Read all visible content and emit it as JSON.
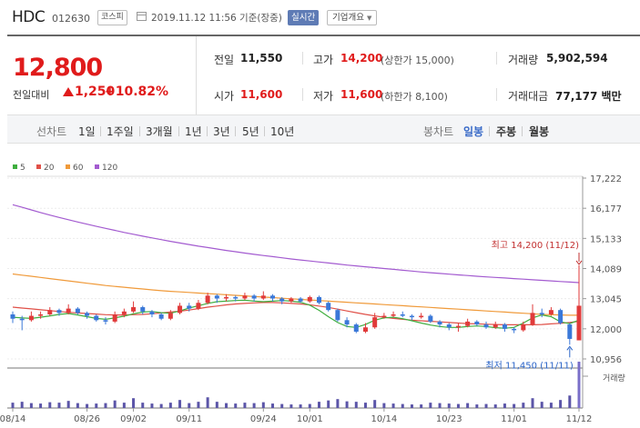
{
  "header": {
    "name": "HDC",
    "code": "012630",
    "market_badge": "코스피",
    "datetime": "2019.11.12 11:56 기준(장중)",
    "realtime_button": "실시간",
    "company_info_label": "기업개요"
  },
  "quote": {
    "price": "12,800",
    "change_label": "전일대비",
    "change_value": "1,250",
    "change_pct": "+10.82%",
    "prev_label": "전일",
    "prev_value": "11,550",
    "high_label": "고가",
    "high_value": "14,200",
    "upper_limit": "(상한가 15,000)",
    "volume_label": "거래량",
    "volume_value": "5,902,594",
    "open_label": "시가",
    "open_value": "11,600",
    "low_label": "저가",
    "low_value": "11,600",
    "lower_limit": "(하한가 8,100)",
    "amount_label": "거래대금",
    "amount_value": "77,177 백만"
  },
  "toolbar": {
    "line_chart_label": "선차트",
    "periods": [
      "1일",
      "1주일",
      "3개월",
      "1년",
      "3년",
      "5년",
      "10년"
    ],
    "candle_chart_label": "봉차트",
    "candle_periods": [
      "일봉",
      "주봉",
      "월봉"
    ],
    "active_candle": "일봉"
  },
  "chart_data": {
    "type": "candlestick",
    "legend": [
      "5",
      "20",
      "60",
      "120"
    ],
    "ma_colors": {
      "5": "#3fae3f",
      "20": "#e05048",
      "60": "#f09a3a",
      "120": "#a35bd0"
    },
    "up_color": "#e03a3a",
    "down_color": "#3a78d8",
    "y_ticks": [
      "17,222",
      "16,177",
      "15,133",
      "14,089",
      "13,045",
      "12,000",
      "10,956"
    ],
    "y_tick_values": [
      17222,
      16177,
      15133,
      14089,
      13045,
      12000,
      10956
    ],
    "x_labels": [
      "08/14",
      "08/26",
      "09/02",
      "09/11",
      "09/24",
      "10/01",
      "10/14",
      "10/23",
      "11/01",
      "11/12"
    ],
    "x_label_index": [
      0,
      8,
      13,
      19,
      27,
      32,
      40,
      47,
      54,
      61
    ],
    "volume_label": "거래량",
    "high_annotation": "최고 14,200 (11/12)",
    "low_annotation": "최저 11,450 (11/11)",
    "ma120": [
      16300,
      16210,
      16120,
      16030,
      15940,
      15860,
      15780,
      15700,
      15625,
      15550,
      15480,
      15410,
      15340,
      15275,
      15210,
      15150,
      15090,
      15030,
      14975,
      14920,
      14865,
      14815,
      14765,
      14715,
      14670,
      14625,
      14580,
      14540,
      14500,
      14460,
      14420,
      14385,
      14350,
      14315,
      14280,
      14245,
      14210,
      14180,
      14150,
      14120,
      14090,
      14060,
      14030,
      14000,
      13970,
      13945,
      13920,
      13895,
      13870,
      13845,
      13820,
      13800,
      13780,
      13760,
      13740,
      13720,
      13700,
      13680,
      13660,
      13640,
      13620,
      13600
    ],
    "ma60": [
      13900,
      13860,
      13820,
      13780,
      13740,
      13700,
      13660,
      13620,
      13580,
      13540,
      13500,
      13470,
      13440,
      13410,
      13380,
      13350,
      13320,
      13300,
      13280,
      13260,
      13240,
      13220,
      13200,
      13180,
      13160,
      13140,
      13120,
      13100,
      13080,
      13060,
      13040,
      13020,
      13000,
      12980,
      12960,
      12940,
      12920,
      12900,
      12880,
      12860,
      12840,
      12820,
      12800,
      12780,
      12760,
      12740,
      12720,
      12700,
      12680,
      12660,
      12640,
      12620,
      12600,
      12580,
      12560,
      12540,
      12520,
      12500,
      12490,
      12480,
      12470,
      12470
    ],
    "ma20": [
      12750,
      12720,
      12690,
      12660,
      12630,
      12600,
      12570,
      12550,
      12530,
      12510,
      12490,
      12480,
      12480,
      12490,
      12500,
      12520,
      12550,
      12580,
      12610,
      12650,
      12700,
      12750,
      12790,
      12830,
      12860,
      12880,
      12900,
      12910,
      12910,
      12900,
      12880,
      12860,
      12830,
      12790,
      12740,
      12680,
      12620,
      12560,
      12500,
      12450,
      12400,
      12360,
      12330,
      12300,
      12280,
      12260,
      12240,
      12220,
      12200,
      12180,
      12170,
      12160,
      12150,
      12140,
      12140,
      12140,
      12140,
      12150,
      12170,
      12190,
      12220,
      12260
    ],
    "ma5": [
      12400,
      12380,
      12360,
      12400,
      12450,
      12500,
      12530,
      12480,
      12420,
      12360,
      12330,
      12380,
      12440,
      12520,
      12580,
      12600,
      12560,
      12540,
      12620,
      12720,
      12800,
      12880,
      12940,
      12960,
      12980,
      12990,
      12960,
      12940,
      12960,
      12980,
      12960,
      12920,
      12820,
      12640,
      12420,
      12220,
      12080,
      12050,
      12150,
      12300,
      12380,
      12400,
      12350,
      12280,
      12200,
      12130,
      12080,
      12050,
      12050,
      12080,
      12100,
      12080,
      12040,
      12020,
      12050,
      12200,
      12380,
      12480,
      12420,
      12240,
      12180,
      12300
    ],
    "candles": [
      {
        "o": 12500,
        "c": 12350,
        "h": 12600,
        "l": 12200,
        "v": 60
      },
      {
        "o": 12350,
        "c": 12300,
        "h": 12450,
        "l": 11950,
        "v": 70
      },
      {
        "o": 12300,
        "c": 12450,
        "h": 12600,
        "l": 12250,
        "v": 55
      },
      {
        "o": 12450,
        "c": 12500,
        "h": 12600,
        "l": 12350,
        "v": 50
      },
      {
        "o": 12500,
        "c": 12650,
        "h": 12750,
        "l": 12450,
        "v": 65
      },
      {
        "o": 12650,
        "c": 12550,
        "h": 12700,
        "l": 12450,
        "v": 60
      },
      {
        "o": 12550,
        "c": 12700,
        "h": 12850,
        "l": 12500,
        "v": 80
      },
      {
        "o": 12700,
        "c": 12550,
        "h": 12750,
        "l": 12500,
        "v": 55
      },
      {
        "o": 12550,
        "c": 12450,
        "h": 12600,
        "l": 12350,
        "v": 45
      },
      {
        "o": 12450,
        "c": 12300,
        "h": 12500,
        "l": 12250,
        "v": 50
      },
      {
        "o": 12300,
        "c": 12250,
        "h": 12400,
        "l": 12150,
        "v": 55
      },
      {
        "o": 12250,
        "c": 12500,
        "h": 12600,
        "l": 12200,
        "v": 85
      },
      {
        "o": 12500,
        "c": 12600,
        "h": 12700,
        "l": 12400,
        "v": 60
      },
      {
        "o": 12600,
        "c": 12750,
        "h": 12950,
        "l": 12550,
        "v": 110
      },
      {
        "o": 12750,
        "c": 12600,
        "h": 12800,
        "l": 12500,
        "v": 60
      },
      {
        "o": 12600,
        "c": 12500,
        "h": 12650,
        "l": 12400,
        "v": 50
      },
      {
        "o": 12500,
        "c": 12350,
        "h": 12550,
        "l": 12300,
        "v": 45
      },
      {
        "o": 12350,
        "c": 12550,
        "h": 12650,
        "l": 12300,
        "v": 60
      },
      {
        "o": 12550,
        "c": 12800,
        "h": 12900,
        "l": 12500,
        "v": 90
      },
      {
        "o": 12800,
        "c": 12700,
        "h": 12900,
        "l": 12600,
        "v": 55
      },
      {
        "o": 12700,
        "c": 12900,
        "h": 13000,
        "l": 12650,
        "v": 70
      },
      {
        "o": 12900,
        "c": 13150,
        "h": 13250,
        "l": 12850,
        "v": 120
      },
      {
        "o": 13150,
        "c": 13050,
        "h": 13200,
        "l": 12900,
        "v": 70
      },
      {
        "o": 13050,
        "c": 13100,
        "h": 13200,
        "l": 12950,
        "v": 55
      },
      {
        "o": 13100,
        "c": 13050,
        "h": 13150,
        "l": 12950,
        "v": 50
      },
      {
        "o": 13050,
        "c": 13150,
        "h": 13250,
        "l": 13000,
        "v": 60
      },
      {
        "o": 13150,
        "c": 13050,
        "h": 13200,
        "l": 12950,
        "v": 55
      },
      {
        "o": 13050,
        "c": 13150,
        "h": 13300,
        "l": 13000,
        "v": 65
      },
      {
        "o": 13150,
        "c": 13050,
        "h": 13200,
        "l": 12950,
        "v": 50
      },
      {
        "o": 13050,
        "c": 12950,
        "h": 13100,
        "l": 12850,
        "v": 45
      },
      {
        "o": 12950,
        "c": 13050,
        "h": 13100,
        "l": 12900,
        "v": 40
      },
      {
        "o": 13050,
        "c": 12950,
        "h": 13100,
        "l": 12900,
        "v": 40
      },
      {
        "o": 12950,
        "c": 13100,
        "h": 13150,
        "l": 12900,
        "v": 45
      },
      {
        "o": 13100,
        "c": 12900,
        "h": 13150,
        "l": 12850,
        "v": 70
      },
      {
        "o": 12900,
        "c": 12650,
        "h": 12950,
        "l": 12600,
        "v": 85
      },
      {
        "o": 12650,
        "c": 12300,
        "h": 12700,
        "l": 12250,
        "v": 100
      },
      {
        "o": 12300,
        "c": 12150,
        "h": 12400,
        "l": 12050,
        "v": 75
      },
      {
        "o": 12150,
        "c": 11900,
        "h": 12200,
        "l": 11850,
        "v": 70
      },
      {
        "o": 11900,
        "c": 12050,
        "h": 12200,
        "l": 11850,
        "v": 60
      },
      {
        "o": 12050,
        "c": 12400,
        "h": 12550,
        "l": 12000,
        "v": 90
      },
      {
        "o": 12400,
        "c": 12450,
        "h": 12550,
        "l": 12350,
        "v": 55
      },
      {
        "o": 12450,
        "c": 12500,
        "h": 12600,
        "l": 12400,
        "v": 50
      },
      {
        "o": 12500,
        "c": 12450,
        "h": 12600,
        "l": 12400,
        "v": 45
      },
      {
        "o": 12450,
        "c": 12400,
        "h": 12500,
        "l": 12300,
        "v": 40
      },
      {
        "o": 12400,
        "c": 12450,
        "h": 12550,
        "l": 12350,
        "v": 40
      },
      {
        "o": 12450,
        "c": 12250,
        "h": 12500,
        "l": 12200,
        "v": 60
      },
      {
        "o": 12250,
        "c": 12150,
        "h": 12300,
        "l": 12050,
        "v": 55
      },
      {
        "o": 12150,
        "c": 12050,
        "h": 12200,
        "l": 11950,
        "v": 50
      },
      {
        "o": 12050,
        "c": 12100,
        "h": 12200,
        "l": 11900,
        "v": 45
      },
      {
        "o": 12100,
        "c": 12250,
        "h": 12350,
        "l": 12050,
        "v": 55
      },
      {
        "o": 12250,
        "c": 12150,
        "h": 12300,
        "l": 12100,
        "v": 40
      },
      {
        "o": 12150,
        "c": 12050,
        "h": 12250,
        "l": 12000,
        "v": 45
      },
      {
        "o": 12050,
        "c": 12150,
        "h": 12250,
        "l": 12000,
        "v": 40
      },
      {
        "o": 12150,
        "c": 12000,
        "h": 12200,
        "l": 11900,
        "v": 50
      },
      {
        "o": 12000,
        "c": 11950,
        "h": 12050,
        "l": 11850,
        "v": 45
      },
      {
        "o": 11950,
        "c": 12150,
        "h": 12250,
        "l": 11900,
        "v": 60
      },
      {
        "o": 12150,
        "c": 12550,
        "h": 12850,
        "l": 12100,
        "v": 110
      },
      {
        "o": 12550,
        "c": 12500,
        "h": 12700,
        "l": 12400,
        "v": 70
      },
      {
        "o": 12500,
        "c": 12650,
        "h": 12750,
        "l": 12450,
        "v": 60
      },
      {
        "o": 12650,
        "c": 12200,
        "h": 12700,
        "l": 12150,
        "v": 90
      },
      {
        "o": 12150,
        "c": 11650,
        "h": 12200,
        "l": 11450,
        "v": 140
      },
      {
        "o": 11600,
        "c": 12800,
        "h": 14200,
        "l": 11600,
        "v": 520
      }
    ]
  }
}
